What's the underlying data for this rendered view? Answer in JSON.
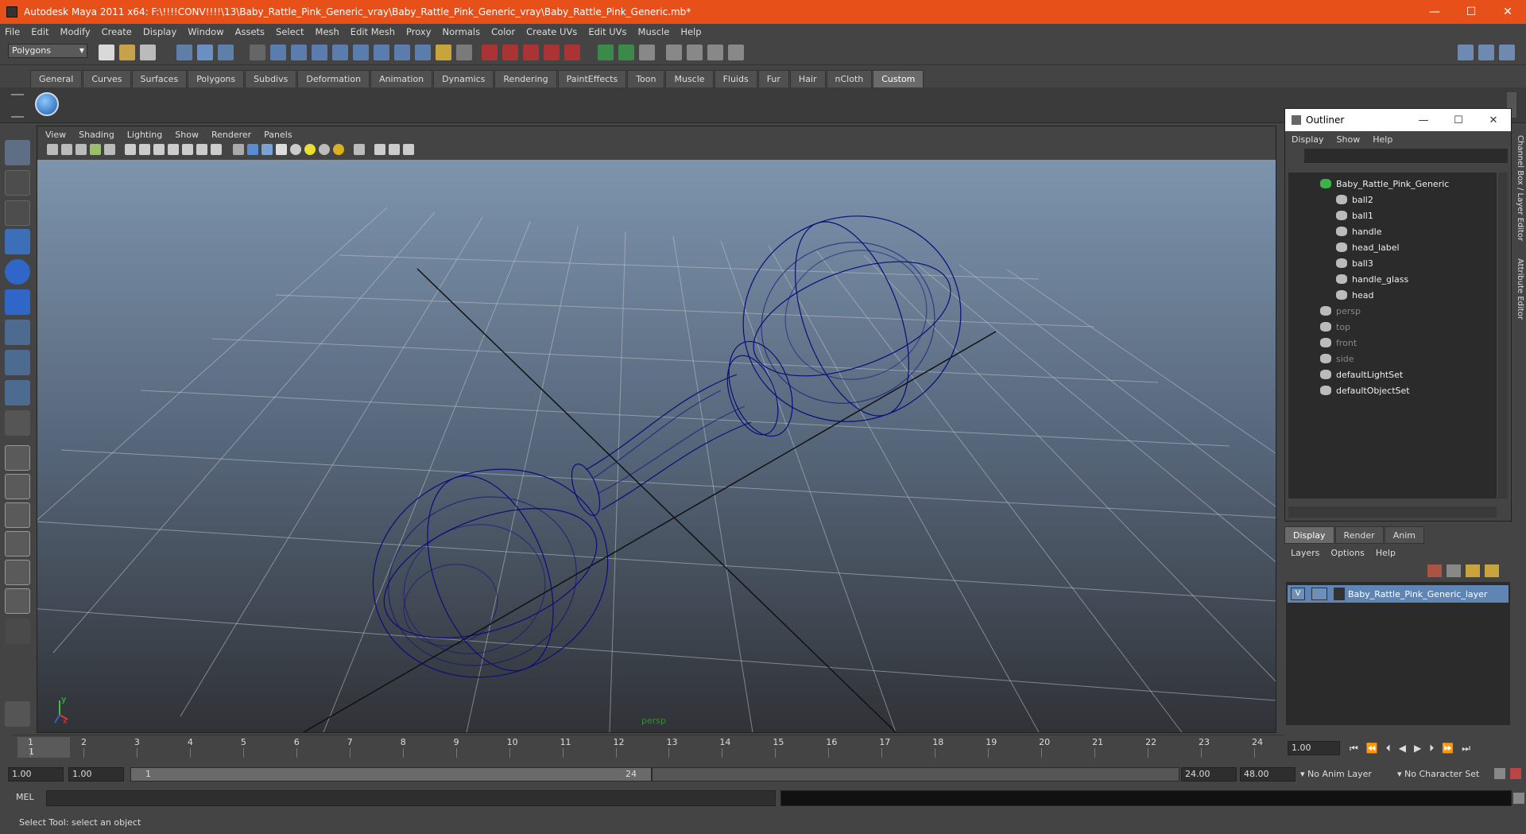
{
  "window": {
    "title": "Autodesk Maya 2011 x64: F:\\!!!!CONV!!!!\\13\\Baby_Rattle_Pink_Generic_vray\\Baby_Rattle_Pink_Generic_vray\\Baby_Rattle_Pink_Generic.mb*",
    "minimize": "—",
    "maximize": "☐",
    "close": "✕"
  },
  "menu": [
    "File",
    "Edit",
    "Modify",
    "Create",
    "Display",
    "Window",
    "Assets",
    "Select",
    "Mesh",
    "Edit Mesh",
    "Proxy",
    "Normals",
    "Color",
    "Create UVs",
    "Edit UVs",
    "Muscle",
    "Help"
  ],
  "mode_selector": "Polygons",
  "shelf_tabs": [
    "General",
    "Curves",
    "Surfaces",
    "Polygons",
    "Subdivs",
    "Deformation",
    "Animation",
    "Dynamics",
    "Rendering",
    "PaintEffects",
    "Toon",
    "Muscle",
    "Fluids",
    "Fur",
    "Hair",
    "nCloth",
    "Custom"
  ],
  "shelf_active": "Custom",
  "viewport": {
    "menu": [
      "View",
      "Shading",
      "Lighting",
      "Show",
      "Renderer",
      "Panels"
    ],
    "camera": "persp",
    "axis_y": "y",
    "axis_x": "x",
    "wire_color": "#0c0c7a"
  },
  "outliner": {
    "title": "Outliner",
    "menu": [
      "Display",
      "Show",
      "Help"
    ],
    "items": [
      {
        "label": "Baby_Rattle_Pink_Generic",
        "level": 0,
        "dim": false
      },
      {
        "label": "ball2",
        "level": 1,
        "dim": false
      },
      {
        "label": "ball1",
        "level": 1,
        "dim": false
      },
      {
        "label": "handle",
        "level": 1,
        "dim": false
      },
      {
        "label": "head_label",
        "level": 1,
        "dim": false
      },
      {
        "label": "ball3",
        "level": 1,
        "dim": false
      },
      {
        "label": "handle_glass",
        "level": 1,
        "dim": false
      },
      {
        "label": "head",
        "level": 1,
        "dim": false
      },
      {
        "label": "persp",
        "level": 0,
        "dim": true
      },
      {
        "label": "top",
        "level": 0,
        "dim": true
      },
      {
        "label": "front",
        "level": 0,
        "dim": true
      },
      {
        "label": "side",
        "level": 0,
        "dim": true
      },
      {
        "label": "defaultLightSet",
        "level": 0,
        "dim": false
      },
      {
        "label": "defaultObjectSet",
        "level": 0,
        "dim": false
      }
    ]
  },
  "side_tabs": {
    "channel_box": "Channel Box / Layer Editor",
    "attribute_editor": "Attribute Editor"
  },
  "layers": {
    "tabs": [
      "Display",
      "Render",
      "Anim"
    ],
    "active_tab": "Display",
    "menu": [
      "Layers",
      "Options",
      "Help"
    ],
    "visible_flag": "V",
    "layer_name": "Baby_Rattle_Pink_Generic_layer"
  },
  "timeline": {
    "ticks": [
      "1",
      "2",
      "3",
      "4",
      "5",
      "6",
      "7",
      "8",
      "9",
      "10",
      "11",
      "12",
      "13",
      "14",
      "15",
      "16",
      "17",
      "18",
      "19",
      "20",
      "21",
      "22",
      "23",
      "24"
    ],
    "current_frame": "1",
    "current_time_field": "1.00"
  },
  "range": {
    "start_time": "1.00",
    "playback_start": "1.00",
    "range_start": "1",
    "range_end": "24",
    "playback_end": "24.00",
    "end_time": "48.00",
    "anim_layer": "No Anim Layer",
    "character_set": "No Character Set"
  },
  "command": {
    "label": "MEL"
  },
  "help_line": "Select Tool: select an object"
}
